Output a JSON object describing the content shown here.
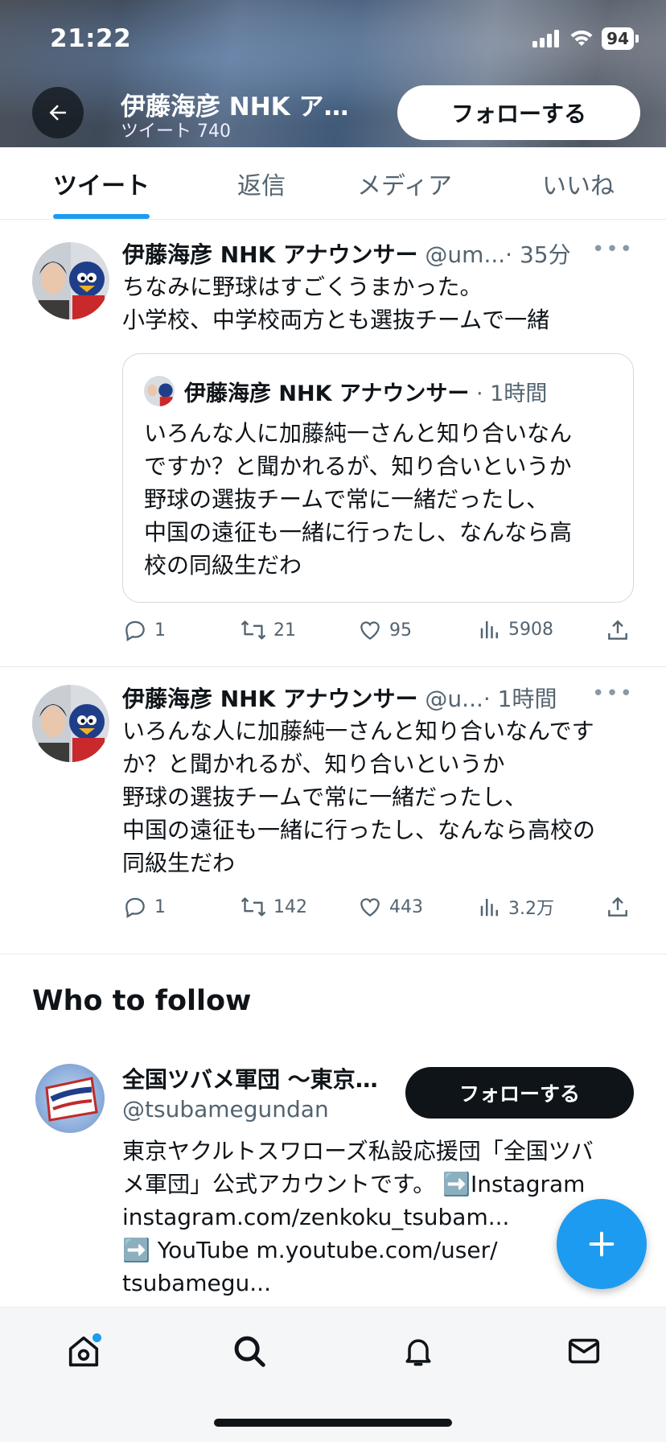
{
  "status_bar": {
    "time": "21:22",
    "battery": "94"
  },
  "header": {
    "title": "伊藤海彦 NHK ア…",
    "subtitle": "ツイート 740",
    "follow_label": "フォローする"
  },
  "tabs": [
    {
      "label": "ツイート",
      "active": true
    },
    {
      "label": "返信"
    },
    {
      "label": "メディア"
    },
    {
      "label": "いいね"
    }
  ],
  "tweets": [
    {
      "name": "伊藤海彦 NHK アナウンサー",
      "handle": "@um...",
      "time": "· 35分",
      "body": "ちなみに野球はすごくうまかった。\n小学校、中学校両方とも選抜チームで一緒",
      "quote": {
        "name": "伊藤海彦 NHK アナウンサー",
        "time": "· 1時間",
        "body": "いろんな人に加藤純一さんと知り合いなん\nですか？と聞かれるが、知り合いというか\n野球の選抜チームで常に一緒だったし、\n中国の遠征も一緒に行ったし、なんなら高\n校の同級生だわ"
      },
      "stats": {
        "replies": "1",
        "retweets": "21",
        "likes": "95",
        "views": "5908"
      }
    },
    {
      "name": "伊藤海彦 NHK アナウンサー",
      "handle": "@u...",
      "time": "· 1時間",
      "body": "いろんな人に加藤純一さんと知り合いなんです\nか？と聞かれるが、知り合いというか\n野球の選抜チームで常に一緒だったし、\n中国の遠征も一緒に行ったし、なんなら高校の\n同級生だわ",
      "stats": {
        "replies": "1",
        "retweets": "142",
        "likes": "443",
        "views": "3.2万"
      }
    }
  ],
  "who_to_follow": {
    "title": "Who to follow",
    "account": {
      "name": "全国ツバメ軍団 〜東京…",
      "handle": "@tsubamegundan",
      "follow_label": "フォローする",
      "bio_lines": [
        "東京ヤクルトスワローズ私設応援団「全国ツバ",
        "メ軍団」公式アカウントです。 ➡️Instagram",
        "instagram.com/zenkoku_tsubam...",
        "➡️ YouTube m.youtube.com/user/",
        "tsubamegu..."
      ]
    }
  },
  "colors": {
    "accent": "#1d9bf0",
    "text": "#0f1419",
    "muted": "#536471",
    "border": "#e6e9ec"
  },
  "icons": {
    "back": "arrow-left-icon",
    "reply": "reply-icon",
    "retweet": "retweet-icon",
    "like": "heart-icon",
    "views": "views-icon",
    "share": "share-icon",
    "compose": "plus-icon",
    "home": "home-icon",
    "search": "search-icon",
    "notifications": "bell-icon",
    "messages": "mail-icon"
  }
}
